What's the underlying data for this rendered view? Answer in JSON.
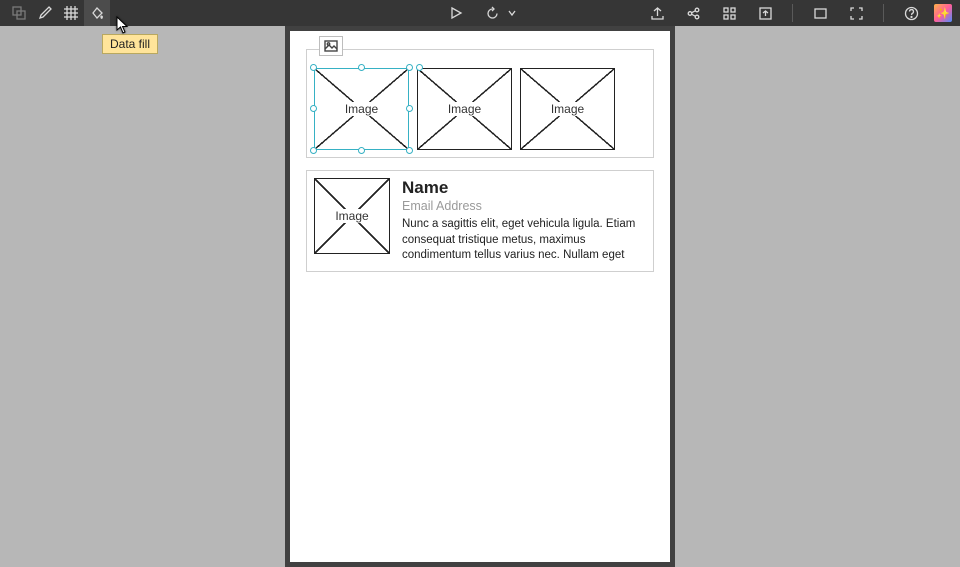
{
  "tooltip": "Data fill",
  "canvas": {
    "row": {
      "img_label_1": "Image",
      "img_label_2": "Image",
      "img_label_3": "Image"
    },
    "card": {
      "img_label": "Image",
      "name": "Name",
      "email": "Email Address",
      "body": "Nunc a sagittis elit, eget vehicula ligula. Etiam consequat tristique metus, maximus condimentum tellus varius nec. Nullam eget"
    }
  }
}
